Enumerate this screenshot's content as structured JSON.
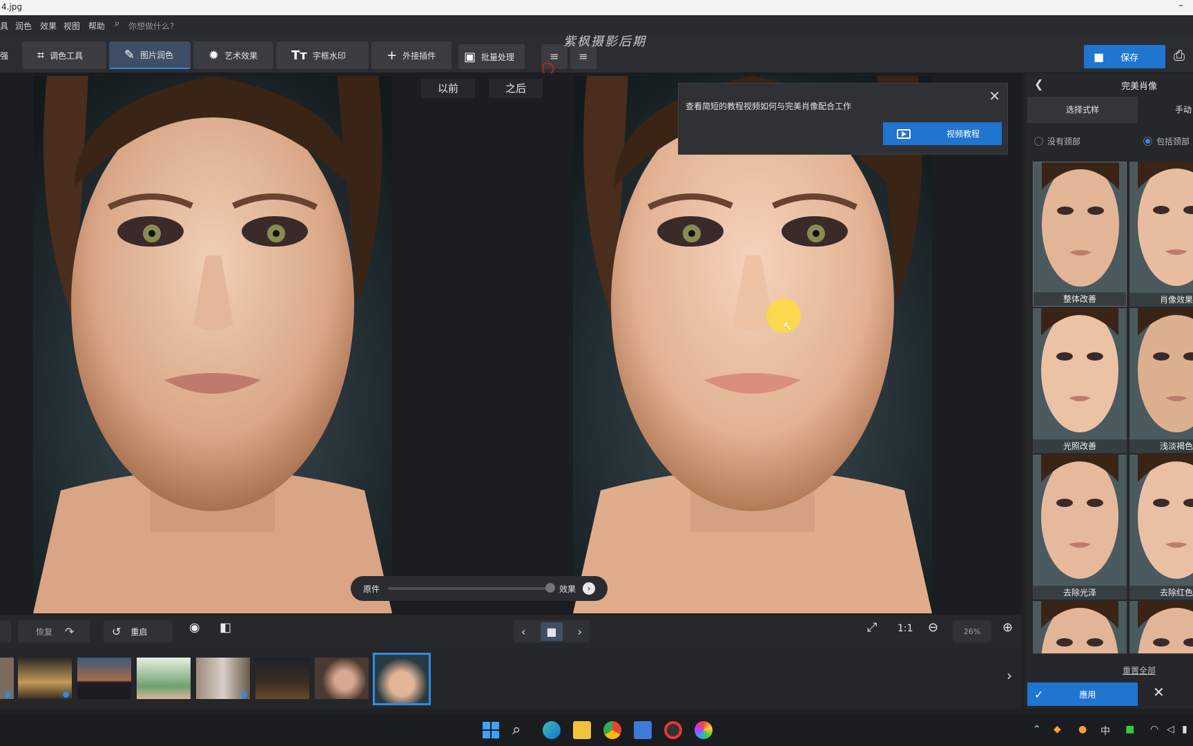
{
  "window": {
    "title": "4.jpg",
    "minimize": "–"
  },
  "menu": {
    "items": [
      "具",
      "润色",
      "效果",
      "视图",
      "帮助"
    ],
    "search_placeholder": "你想做什么?"
  },
  "toolbar": {
    "partial_left": "强",
    "tools": [
      {
        "label": "调色工具",
        "icon": "crop-icon"
      },
      {
        "label": "图片润色",
        "icon": "brush-icon"
      },
      {
        "label": "艺术效果",
        "icon": "sparkle-icon"
      },
      {
        "label": "字框水印",
        "icon": "text-icon"
      },
      {
        "label": "外接插件",
        "icon": "plus-icon"
      },
      {
        "label": "批量处理",
        "icon": "images-icon"
      }
    ],
    "watermark": "紫枫摄影后期",
    "save_label": "保存"
  },
  "canvas": {
    "before_label": "以前",
    "after_label": "之后",
    "slider_left": "原件",
    "slider_right": "效果"
  },
  "tutorial_popup": {
    "message": "查看简短的教程视频如何与完美肖像配合工作",
    "button_label": "视频教程"
  },
  "right_panel": {
    "title": "完美肖像",
    "tabs": [
      "选择式样",
      "手动"
    ],
    "radio_options": [
      {
        "label": "没有颈部",
        "checked": false
      },
      {
        "label": "包括颈部",
        "checked": true
      }
    ],
    "presets": [
      "整体改善",
      "肖像效果",
      "光照改善",
      "浅淡褐色",
      "去除光泽",
      "去除红色",
      "",
      ""
    ],
    "reset_all": "重置全部",
    "apply_label": "應用"
  },
  "bottom_bar": {
    "undo_label": "恢复",
    "reset_label": "重启",
    "ratio_label": "1:1",
    "zoom_value": "26%"
  },
  "filmstrip": {
    "count": 8,
    "selected_index": 7
  },
  "taskbar": {
    "ime": "中"
  },
  "colors": {
    "accent": "#1f75cf",
    "skin": "#e2b596",
    "bg_dark": "#1f2023"
  }
}
